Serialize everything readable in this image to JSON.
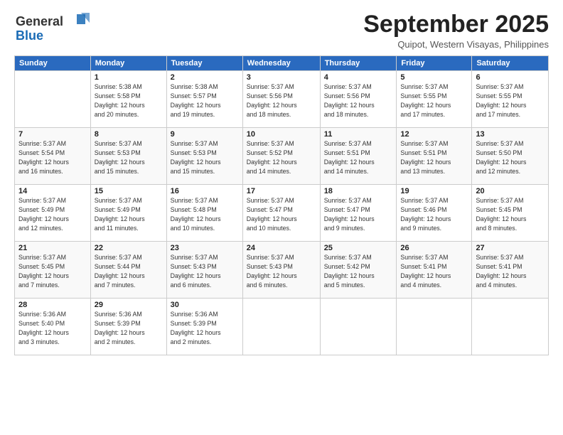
{
  "logo": {
    "line1": "General",
    "line2": "Blue",
    "icon_color": "#1a6bb5"
  },
  "header": {
    "month_title": "September 2025",
    "location": "Quipot, Western Visayas, Philippines"
  },
  "weekdays": [
    "Sunday",
    "Monday",
    "Tuesday",
    "Wednesday",
    "Thursday",
    "Friday",
    "Saturday"
  ],
  "weeks": [
    [
      {
        "day": "",
        "info": ""
      },
      {
        "day": "1",
        "info": "Sunrise: 5:38 AM\nSunset: 5:58 PM\nDaylight: 12 hours\nand 20 minutes."
      },
      {
        "day": "2",
        "info": "Sunrise: 5:38 AM\nSunset: 5:57 PM\nDaylight: 12 hours\nand 19 minutes."
      },
      {
        "day": "3",
        "info": "Sunrise: 5:37 AM\nSunset: 5:56 PM\nDaylight: 12 hours\nand 18 minutes."
      },
      {
        "day": "4",
        "info": "Sunrise: 5:37 AM\nSunset: 5:56 PM\nDaylight: 12 hours\nand 18 minutes."
      },
      {
        "day": "5",
        "info": "Sunrise: 5:37 AM\nSunset: 5:55 PM\nDaylight: 12 hours\nand 17 minutes."
      },
      {
        "day": "6",
        "info": "Sunrise: 5:37 AM\nSunset: 5:55 PM\nDaylight: 12 hours\nand 17 minutes."
      }
    ],
    [
      {
        "day": "7",
        "info": "Sunrise: 5:37 AM\nSunset: 5:54 PM\nDaylight: 12 hours\nand 16 minutes."
      },
      {
        "day": "8",
        "info": "Sunrise: 5:37 AM\nSunset: 5:53 PM\nDaylight: 12 hours\nand 15 minutes."
      },
      {
        "day": "9",
        "info": "Sunrise: 5:37 AM\nSunset: 5:53 PM\nDaylight: 12 hours\nand 15 minutes."
      },
      {
        "day": "10",
        "info": "Sunrise: 5:37 AM\nSunset: 5:52 PM\nDaylight: 12 hours\nand 14 minutes."
      },
      {
        "day": "11",
        "info": "Sunrise: 5:37 AM\nSunset: 5:51 PM\nDaylight: 12 hours\nand 14 minutes."
      },
      {
        "day": "12",
        "info": "Sunrise: 5:37 AM\nSunset: 5:51 PM\nDaylight: 12 hours\nand 13 minutes."
      },
      {
        "day": "13",
        "info": "Sunrise: 5:37 AM\nSunset: 5:50 PM\nDaylight: 12 hours\nand 12 minutes."
      }
    ],
    [
      {
        "day": "14",
        "info": "Sunrise: 5:37 AM\nSunset: 5:49 PM\nDaylight: 12 hours\nand 12 minutes."
      },
      {
        "day": "15",
        "info": "Sunrise: 5:37 AM\nSunset: 5:49 PM\nDaylight: 12 hours\nand 11 minutes."
      },
      {
        "day": "16",
        "info": "Sunrise: 5:37 AM\nSunset: 5:48 PM\nDaylight: 12 hours\nand 10 minutes."
      },
      {
        "day": "17",
        "info": "Sunrise: 5:37 AM\nSunset: 5:47 PM\nDaylight: 12 hours\nand 10 minutes."
      },
      {
        "day": "18",
        "info": "Sunrise: 5:37 AM\nSunset: 5:47 PM\nDaylight: 12 hours\nand 9 minutes."
      },
      {
        "day": "19",
        "info": "Sunrise: 5:37 AM\nSunset: 5:46 PM\nDaylight: 12 hours\nand 9 minutes."
      },
      {
        "day": "20",
        "info": "Sunrise: 5:37 AM\nSunset: 5:45 PM\nDaylight: 12 hours\nand 8 minutes."
      }
    ],
    [
      {
        "day": "21",
        "info": "Sunrise: 5:37 AM\nSunset: 5:45 PM\nDaylight: 12 hours\nand 7 minutes."
      },
      {
        "day": "22",
        "info": "Sunrise: 5:37 AM\nSunset: 5:44 PM\nDaylight: 12 hours\nand 7 minutes."
      },
      {
        "day": "23",
        "info": "Sunrise: 5:37 AM\nSunset: 5:43 PM\nDaylight: 12 hours\nand 6 minutes."
      },
      {
        "day": "24",
        "info": "Sunrise: 5:37 AM\nSunset: 5:43 PM\nDaylight: 12 hours\nand 6 minutes."
      },
      {
        "day": "25",
        "info": "Sunrise: 5:37 AM\nSunset: 5:42 PM\nDaylight: 12 hours\nand 5 minutes."
      },
      {
        "day": "26",
        "info": "Sunrise: 5:37 AM\nSunset: 5:41 PM\nDaylight: 12 hours\nand 4 minutes."
      },
      {
        "day": "27",
        "info": "Sunrise: 5:37 AM\nSunset: 5:41 PM\nDaylight: 12 hours\nand 4 minutes."
      }
    ],
    [
      {
        "day": "28",
        "info": "Sunrise: 5:36 AM\nSunset: 5:40 PM\nDaylight: 12 hours\nand 3 minutes."
      },
      {
        "day": "29",
        "info": "Sunrise: 5:36 AM\nSunset: 5:39 PM\nDaylight: 12 hours\nand 2 minutes."
      },
      {
        "day": "30",
        "info": "Sunrise: 5:36 AM\nSunset: 5:39 PM\nDaylight: 12 hours\nand 2 minutes."
      },
      {
        "day": "",
        "info": ""
      },
      {
        "day": "",
        "info": ""
      },
      {
        "day": "",
        "info": ""
      },
      {
        "day": "",
        "info": ""
      }
    ]
  ]
}
